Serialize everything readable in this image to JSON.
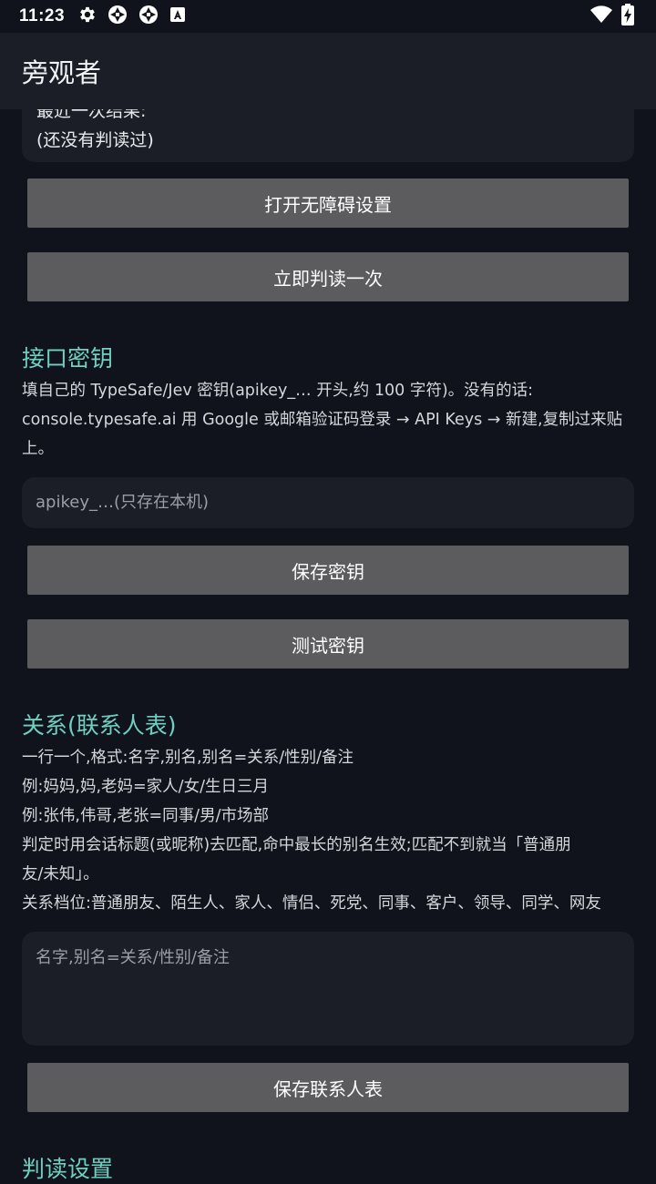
{
  "status_bar": {
    "time": "11:23",
    "left_icons": [
      "gear-icon",
      "aperture-icon",
      "aperture-icon",
      "font-a-icon"
    ],
    "right_icons": [
      "wifi-icon",
      "battery-charging-icon"
    ]
  },
  "app_bar": {
    "title": "旁观者"
  },
  "last_result": {
    "label": "最近一次结果:",
    "value": "(还没有判读过)"
  },
  "buttons": {
    "open_accessibility": "打开无障碍设置",
    "read_now": "立即判读一次",
    "save_key": "保存密钥",
    "test_key": "测试密钥",
    "save_contacts": "保存联系人表"
  },
  "api_key": {
    "title": "接口密钥",
    "desc": [
      "填自己的 TypeSafe/Jev 密钥(apikey_… 开头,约 100 字符)。没有的话:",
      "console.typesafe.ai 用 Google 或邮箱验证码登录 → API Keys → 新建,复制过来贴",
      "上。"
    ],
    "placeholder": "apikey_…(只存在本机)"
  },
  "relations": {
    "title": "关系(联系人表)",
    "desc": [
      "一行一个,格式:名字,别名,别名=关系/性别/备注",
      "例:妈妈,妈,老妈=家人/女/生日三月",
      "例:张伟,伟哥,老张=同事/男/市场部",
      "判定时用会话标题(或昵称)去匹配,命中最长的别名生效;匹配不到就当「普通朋",
      "友/未知」。",
      "关系档位:普通朋友、陌生人、家人、情侣、死党、同事、客户、领导、同学、网友"
    ],
    "placeholder": "名字,别名=关系/性别/备注"
  },
  "read_settings": {
    "title": "判读设置"
  },
  "colors": {
    "background": "#10131b",
    "surface": "#1b1e27",
    "accent": "#6fd0c2",
    "button": "#5c5c5f"
  }
}
